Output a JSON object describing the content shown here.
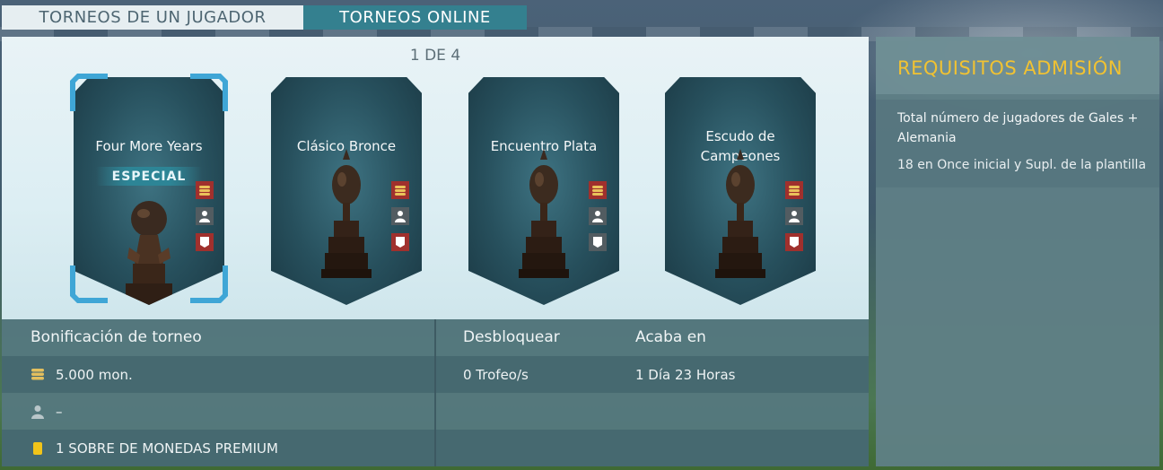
{
  "tabs": {
    "single_player": "TORNEOS DE UN JUGADOR",
    "online": "TORNEOS ONLINE"
  },
  "pager": "1 DE 4",
  "cards": [
    {
      "title": "Four More Years",
      "badge": "ESPECIAL",
      "selected": true
    },
    {
      "title": "Clásico Bronce"
    },
    {
      "title": "Encuentro Plata"
    },
    {
      "title": "Escudo de Campeones"
    }
  ],
  "info": {
    "bonus_header": "Bonificación de torneo",
    "unlock_header": "Desbloquear",
    "ends_header": "Acaba en",
    "coins": "5.000 mon.",
    "player": "–",
    "pack": "1 SOBRE DE MONEDAS PREMIUM",
    "unlock_value": "0 Trofeo/s",
    "ends_value": "1 Día 23 Horas"
  },
  "requirements": {
    "title": "REQUISITOS ADMISIÓN",
    "line1": "Total número de jugadores de Gales + Alemania",
    "line2": "18 en Once inicial y Supl. de la plantilla"
  },
  "colors": {
    "accent_tab": "#34808f",
    "requirements_title": "#f1c232",
    "icon_red": "#a0302d",
    "icon_grey": "#525c61"
  }
}
